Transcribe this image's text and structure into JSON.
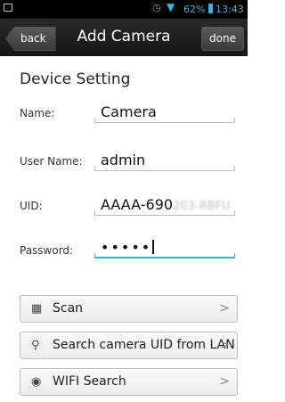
{
  "status": {
    "battery": "62%",
    "time": "13:43",
    "icons": [
      "notification-icon",
      "alarm-icon",
      "wifi-icon",
      "battery-icon"
    ]
  },
  "header": {
    "back_label": "back",
    "title": "Add Camera",
    "done_label": "done"
  },
  "section": {
    "title": "Device Setting"
  },
  "fields": {
    "name": {
      "label": "Name:",
      "value": "Camera"
    },
    "username": {
      "label": "User Name:",
      "value": "admin"
    },
    "uid": {
      "label": "UID:",
      "value": "AAAA-690",
      "obscured_suffix": "203-RBFU"
    },
    "password": {
      "label": "Password:",
      "value": "•••••"
    }
  },
  "buttons": [
    {
      "label": "Scan",
      "icon": "qr-code-icon",
      "chevron": ">"
    },
    {
      "label": "Search camera UID from LAN",
      "icon": "search-icon",
      "chevron": ">"
    },
    {
      "label": "WIFI Search",
      "icon": "wifi-icon",
      "chevron": ">"
    }
  ],
  "colors": {
    "accent": "#35b5e5",
    "titlebar": "#1c1c1c"
  }
}
